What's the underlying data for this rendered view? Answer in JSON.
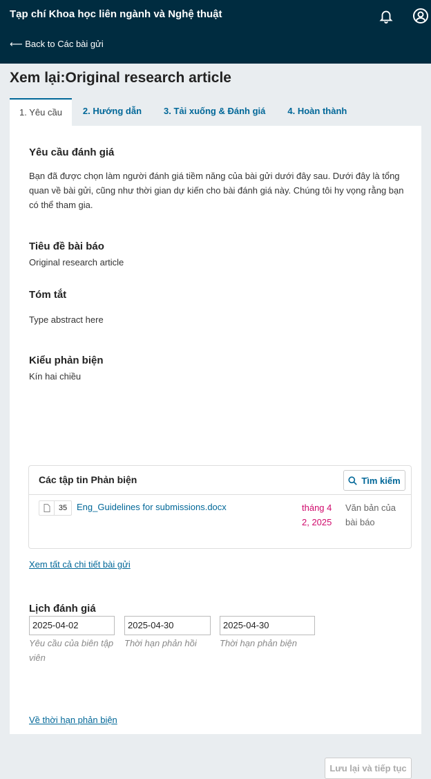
{
  "header": {
    "site_title": "Tạp chí Khoa học liên ngành và Nghệ thuật",
    "back_link": "⟵ Back to Các bài gửi",
    "icons": [
      "bell-icon",
      "user-icon"
    ]
  },
  "page": {
    "title": "Xem lại:Original research article",
    "tabs": [
      {
        "label": "1. Yêu cầu",
        "active": true
      },
      {
        "label": "2. Hướng dẫn",
        "active": false
      },
      {
        "label": "3. Tải xuống & Đánh giá",
        "active": false
      },
      {
        "label": "4. Hoàn thành",
        "active": false
      }
    ]
  },
  "request": {
    "heading": "Yêu cầu đánh giá",
    "body": "Bạn đã được chọn làm người đánh giá tiềm năng của bài gửi dưới đây sau. Dưới đây là tổng quan về bài gửi, cũng như thời gian dự kiến cho bài đánh giá này. Chúng tôi hy vọng rằng bạn có thể tham gia."
  },
  "article": {
    "title_label": "Tiêu đề bài báo",
    "title_value": "Original research article",
    "abstract_label": "Tóm tắt",
    "abstract_value": "Type abstract here",
    "review_type_label": "Kiểu phản biện",
    "review_type_value": "Kín hai chiều"
  },
  "files": {
    "heading": "Các tập tin Phản biện",
    "search_label": "Tìm kiếm",
    "rows": [
      {
        "id": "35",
        "name": "Eng_Guidelines for submissions.docx",
        "date": "tháng 4 2, 2025",
        "type": "Văn bản của bài báo"
      }
    ]
  },
  "view_all_link": "Xem tất cả chi tiết bài gửi",
  "schedule": {
    "heading": "Lịch đánh giá",
    "fields": [
      {
        "value": "2025-04-02",
        "hint": "Yêu cầu của biên tập viên"
      },
      {
        "value": "2025-04-30",
        "hint": "Thời hạn phản hồi"
      },
      {
        "value": "2025-04-30",
        "hint": "Thời hạn phản biện"
      }
    ]
  },
  "deadline_link": "Về thời hạn phản biện",
  "save_button": "Lưu lại và tiếp tục"
}
